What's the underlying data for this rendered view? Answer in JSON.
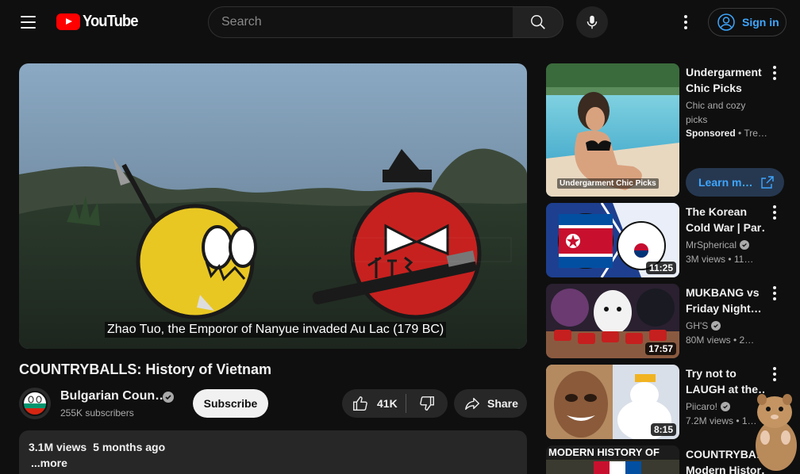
{
  "header": {
    "logo_text": "YouTube",
    "search_placeholder": "Search",
    "signin_label": "Sign in"
  },
  "player": {
    "caption": "Zhao Tuo, the Emporor of Nanyue invaded Au Lac (179 BC)"
  },
  "video": {
    "title": "COUNTRYBALLS: History of Vietnam",
    "channel_name": "Bulgarian Coun…",
    "subscribers": "255K subscribers",
    "subscribe_label": "Subscribe",
    "likes": "41K",
    "share_label": "Share",
    "views": "3.1M views",
    "age": "5 months ago",
    "more_label": "...more"
  },
  "sidebar": {
    "ad": {
      "thumb_label": "Undergarment Chic Picks",
      "title_line1": "Undergarment",
      "title_line2": "Chic Picks",
      "desc_line1": "Chic and cozy",
      "desc_line2": "picks",
      "sponsored": "Sponsored",
      "sponsor_suffix": "• Tre…",
      "learn_label": "Learn m…"
    },
    "items": [
      {
        "title_line1": "The Korean",
        "title_line2": "Cold War | Par…",
        "channel": "MrSpherical",
        "verified": true,
        "meta": "3M views • 11…",
        "duration": "11:25"
      },
      {
        "title_line1": "MUKBANG vs",
        "title_line2": "Friday Night…",
        "channel": "GH'S",
        "verified": true,
        "meta": "80M views • 2…",
        "duration": "17:57"
      },
      {
        "title_line1": "Try not to",
        "title_line2": "LAUGH at the…",
        "channel": "Piicaro!",
        "verified": true,
        "meta": "7.2M views • 1…",
        "duration": "8:15"
      },
      {
        "title_line1": "COUNTRYBA…",
        "title_line2": "Modern Histor…",
        "thumb_text": "MODERN HISTORY OF"
      }
    ]
  },
  "colors": {
    "background": "#0f0f0f",
    "accent_blue": "#3ea6ff",
    "brand_red": "#ff0000"
  }
}
